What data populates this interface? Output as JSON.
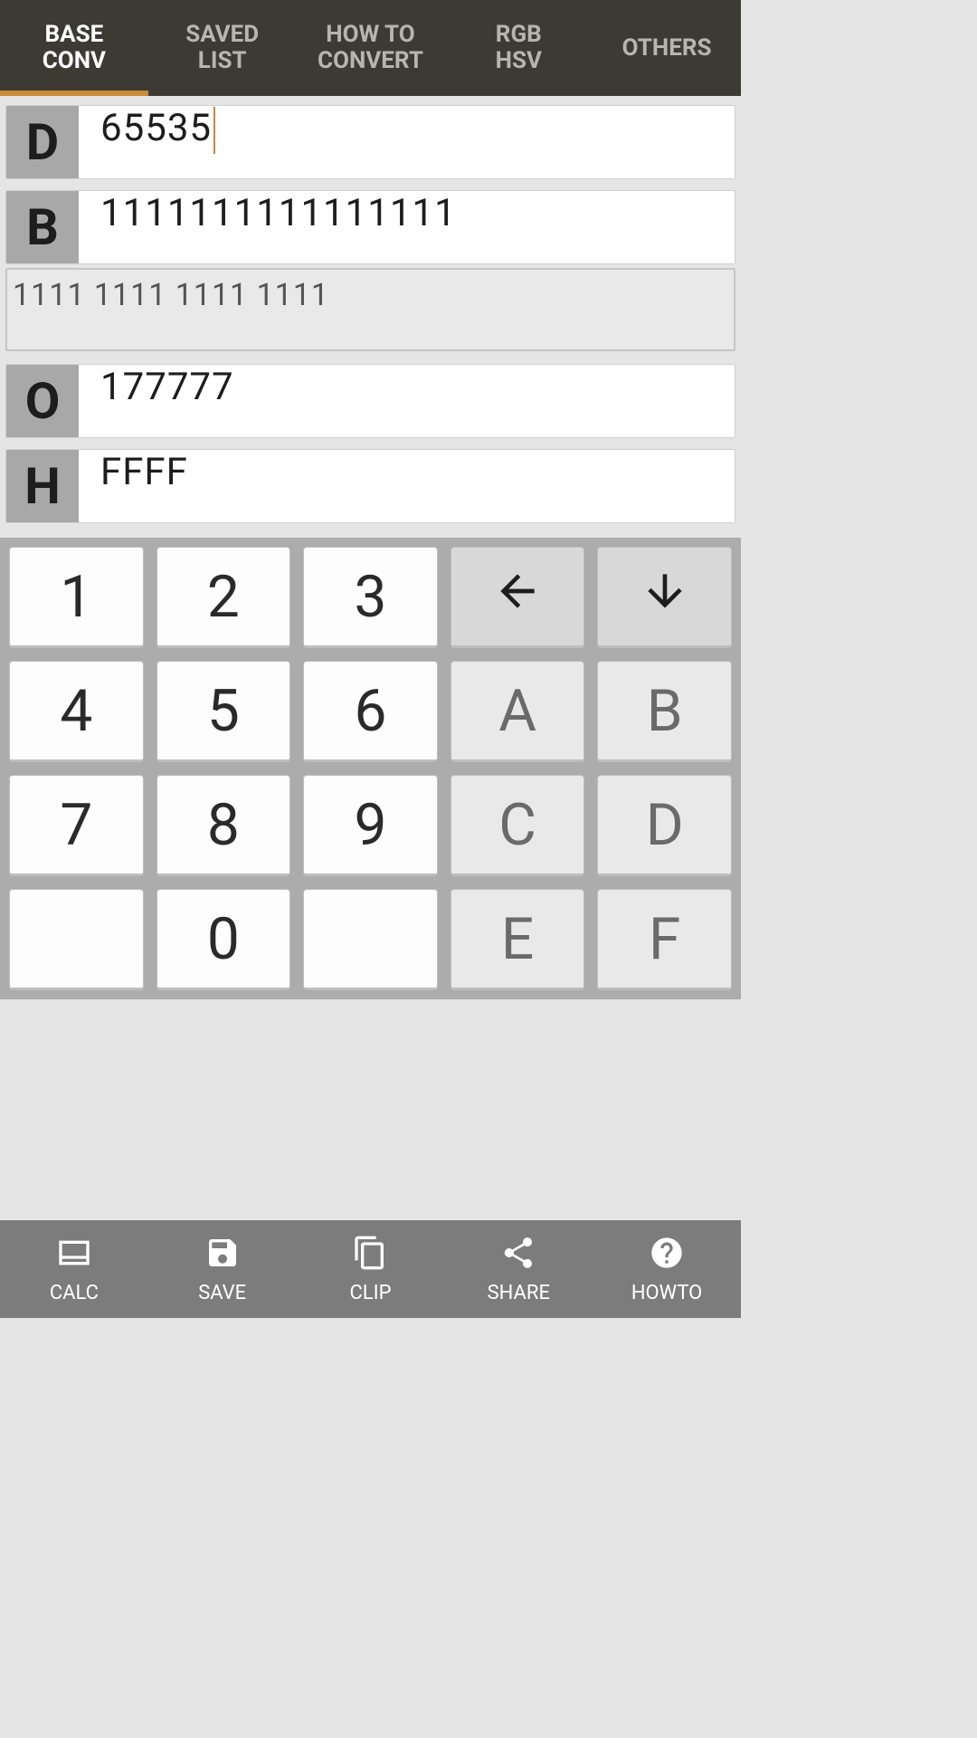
{
  "tabs": [
    {
      "label": "BASE\nCONV",
      "active": true
    },
    {
      "label": "SAVED\nLIST",
      "active": false
    },
    {
      "label": "HOW TO\nCONVERT",
      "active": false
    },
    {
      "label": "RGB\nHSV",
      "active": false
    },
    {
      "label": "OTHERS",
      "active": false
    }
  ],
  "conversions": {
    "decimal": {
      "label": "D",
      "value": "65535"
    },
    "binary": {
      "label": "B",
      "value": "1111111111111111",
      "expanded": "1111 1111 1111 1111"
    },
    "octal": {
      "label": "O",
      "value": "177777"
    },
    "hex": {
      "label": "H",
      "value": "FFFF"
    }
  },
  "keypad": {
    "k1": "1",
    "k2": "2",
    "k3": "3",
    "k4": "4",
    "k5": "5",
    "k6": "6",
    "k7": "7",
    "k8": "8",
    "k9": "9",
    "k0": "0",
    "kA": "A",
    "kB": "B",
    "kC": "C",
    "kD": "D",
    "kE": "E",
    "kF": "F",
    "back_icon": "arrow-left",
    "down_icon": "arrow-down"
  },
  "bottom": [
    {
      "icon": "calc",
      "label": "CALC"
    },
    {
      "icon": "save",
      "label": "SAVE"
    },
    {
      "icon": "clip",
      "label": "CLIP"
    },
    {
      "icon": "share",
      "label": "SHARE"
    },
    {
      "icon": "howto",
      "label": "HOWTO"
    }
  ]
}
